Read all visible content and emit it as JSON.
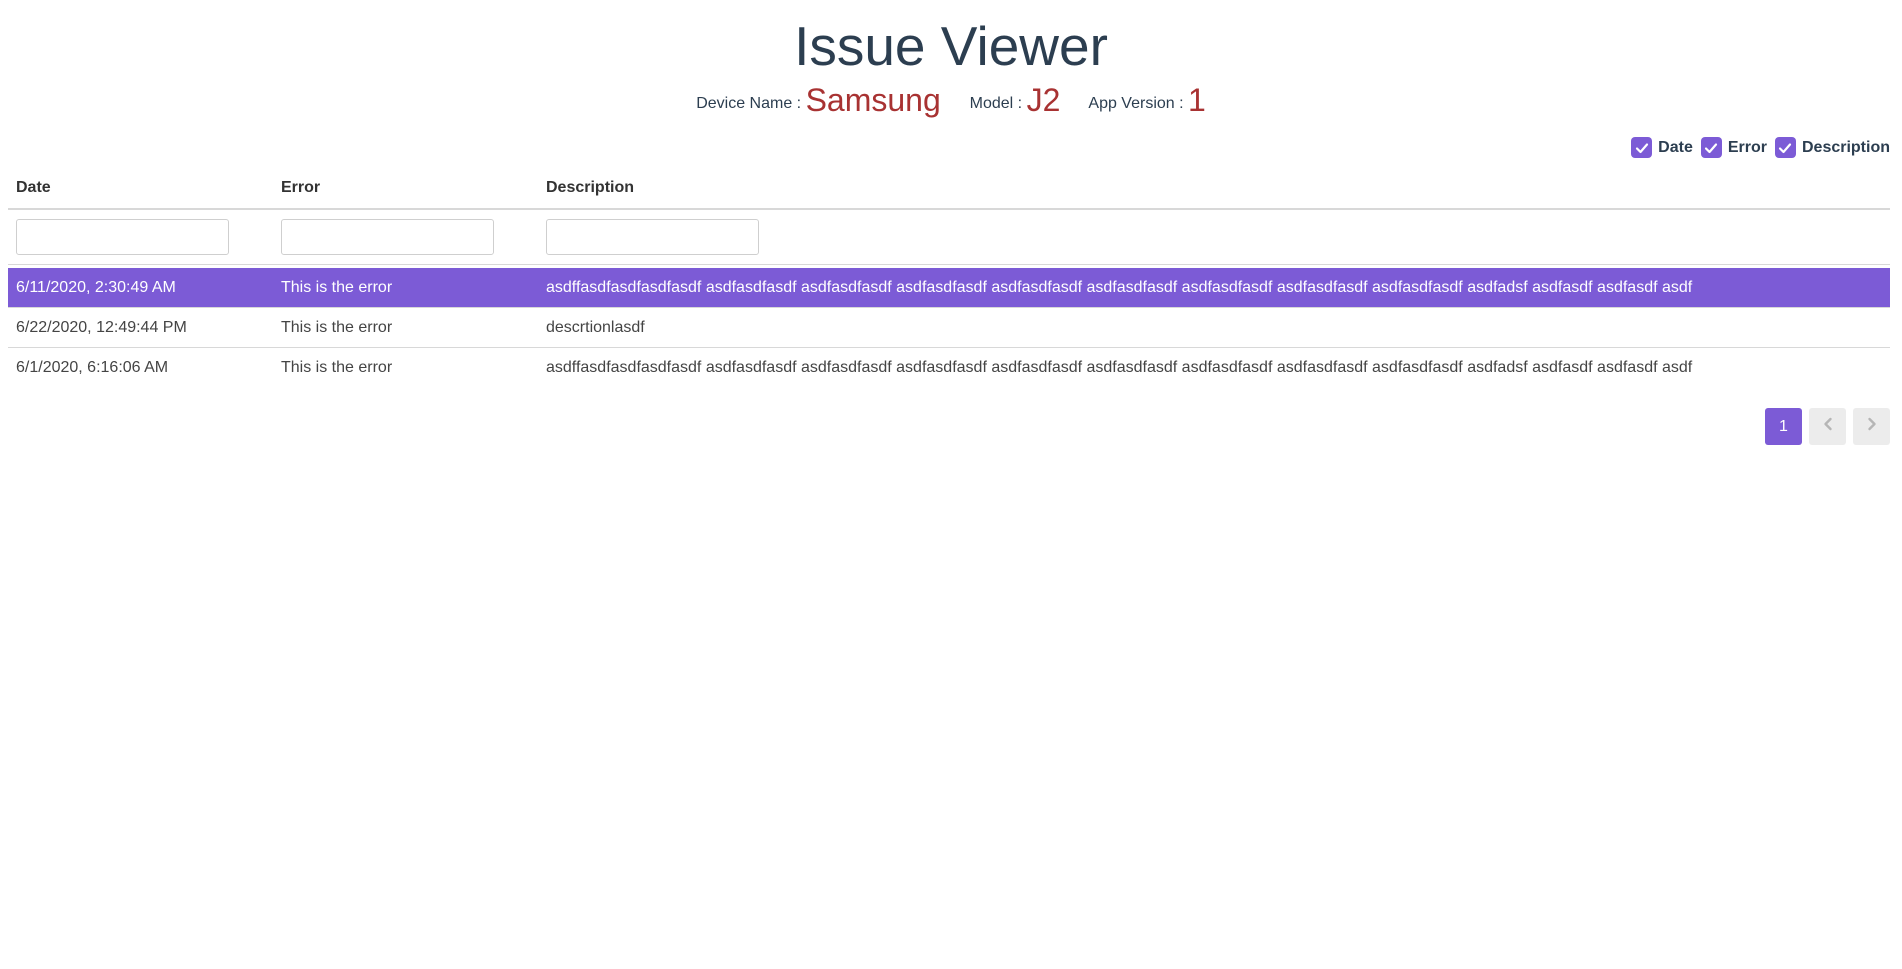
{
  "header": {
    "title": "Issue Viewer",
    "device_name_label": "Device Name :",
    "device_name": "Samsung",
    "model_label": "Model :",
    "model": "J2",
    "app_version_label": "App Version :",
    "app_version": "1"
  },
  "column_toggles": [
    {
      "label": "Date",
      "checked": true
    },
    {
      "label": "Error",
      "checked": true
    },
    {
      "label": "Description",
      "checked": true
    }
  ],
  "table": {
    "columns": [
      "Date",
      "Error",
      "Description"
    ],
    "filters": {
      "date": "",
      "error": "",
      "description": ""
    },
    "rows": [
      {
        "date": "6/11/2020, 2:30:49 AM",
        "error": "This is the error",
        "description": "asdffasdfasdfasdfasdf asdfasdfasdf asdfasdfasdf asdfasdfasdf asdfasdfasdf asdfasdfasdf asdfasdfasdf asdfasdfasdf asdfasdfasdf asdfadsf asdfasdf asdfasdf asdf",
        "selected": true
      },
      {
        "date": "6/22/2020, 12:49:44 PM",
        "error": "This is the error",
        "description": "descrtionlasdf",
        "selected": false
      },
      {
        "date": "6/1/2020, 6:16:06 AM",
        "error": "This is the error",
        "description": "asdffasdfasdfasdfasdf asdfasdfasdf asdfasdfasdf asdfasdfasdf asdfasdfasdf asdfasdfasdf asdfasdfasdf asdfasdfasdf asdfasdfasdf asdfadsf asdfasdf asdfasdf asdf",
        "selected": false
      }
    ]
  },
  "pagination": {
    "current_page": "1",
    "prev_icon": "chevron-left-icon",
    "next_icon": "chevron-right-icon"
  },
  "colors": {
    "accent": "#7c5bd6",
    "value_red": "#a83232",
    "title": "#2c3e50"
  }
}
